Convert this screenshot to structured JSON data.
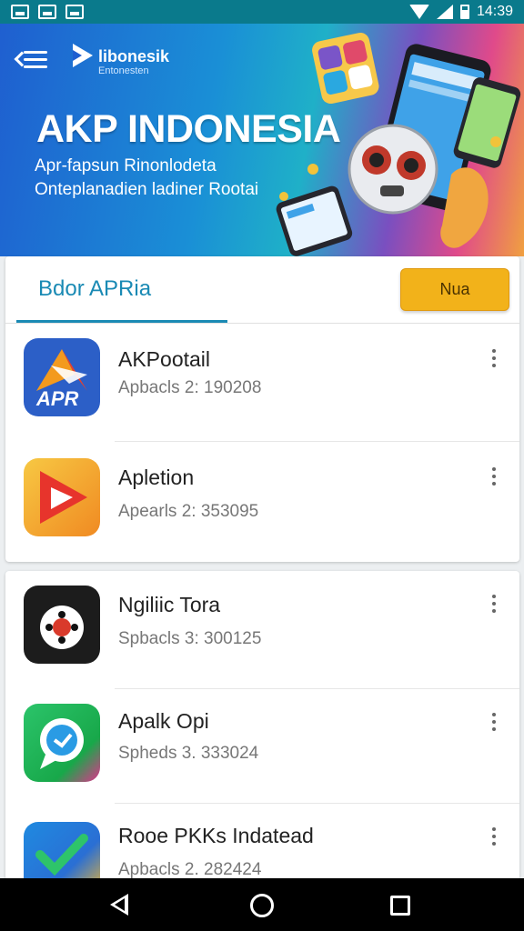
{
  "status_bar": {
    "time": "14:39"
  },
  "header": {
    "logo_name": "libonesik",
    "logo_subtitle": "Entonesten",
    "title": "AKP INDONESIA",
    "subtitle_line1": "Apr-fapsun Rinonlodeta",
    "subtitle_line2": "Onteplanadien ladiner Rootai"
  },
  "list_header": {
    "tab_label": "Bdor APRia",
    "action_button": "Nua"
  },
  "apps": [
    {
      "name": "AKPootail",
      "subtitle": "Apbacls 2: 190208",
      "icon": "apr-logo-icon"
    },
    {
      "name": "Apletion",
      "subtitle": "Apearls 2: 353095",
      "icon": "play-triangle-icon"
    },
    {
      "name": "Ngiliic Tora",
      "subtitle": "Spbacls 3: 300125",
      "icon": "gamepad-icon"
    },
    {
      "name": "Apalk Opi",
      "subtitle": "Spheds 3. 333024",
      "icon": "chat-bubble-icon"
    },
    {
      "name": "Rooe PKKs Indatead",
      "subtitle": "Apbacls 2. 282424",
      "icon": "checkmark-icon"
    }
  ],
  "colors": {
    "accent": "#1a8ab4",
    "button": "#f2b21a",
    "status_bar": "#0a7a8c"
  }
}
